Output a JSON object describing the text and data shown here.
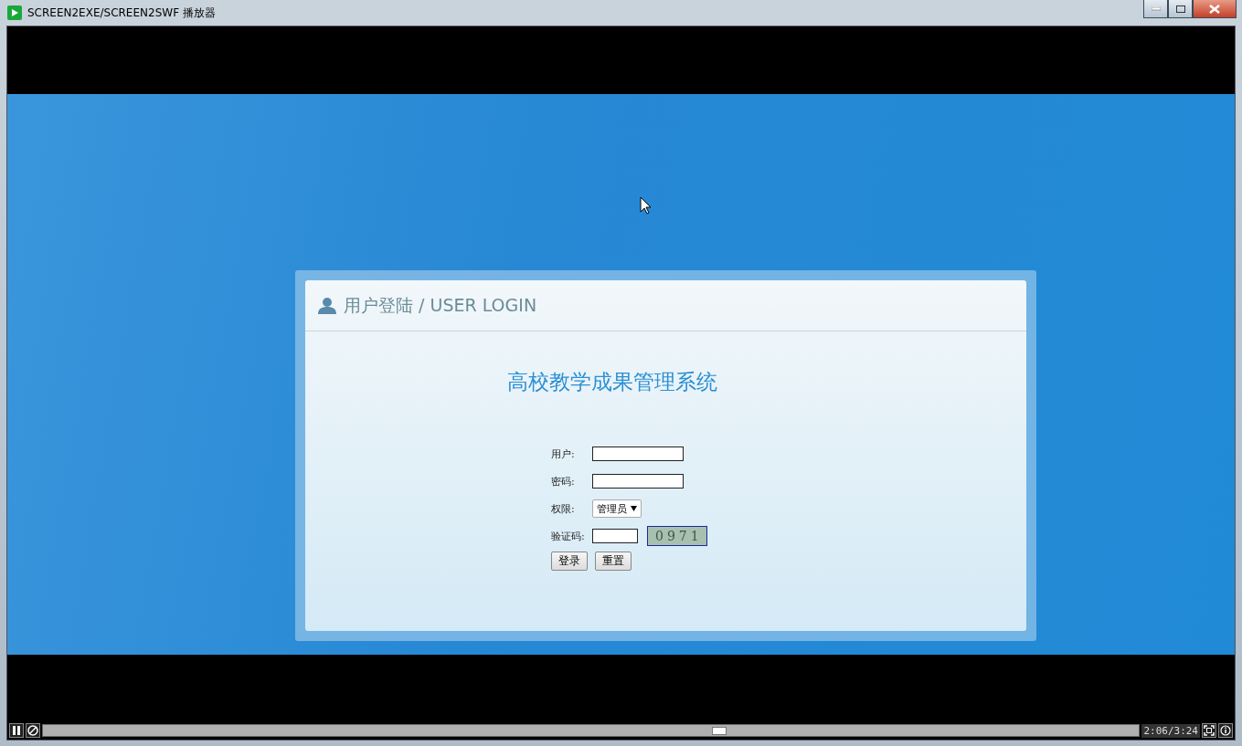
{
  "window": {
    "title": "SCREEN2EXE/SCREEN2SWF 播放器"
  },
  "login": {
    "header": "用户登陆 / USER LOGIN",
    "system_title": "高校教学成果管理系统",
    "fields": [
      {
        "kind": "text",
        "label": "用户:"
      },
      {
        "kind": "password",
        "label": "密码:"
      },
      {
        "kind": "select",
        "label": "权限:",
        "value": "管理员"
      },
      {
        "kind": "captcha",
        "label": "验证码:",
        "captcha": "0971"
      }
    ],
    "buttons": [
      "登录",
      "重置"
    ]
  },
  "player": {
    "playing": true,
    "level": 0.617,
    "time": "2:06/3:24"
  }
}
